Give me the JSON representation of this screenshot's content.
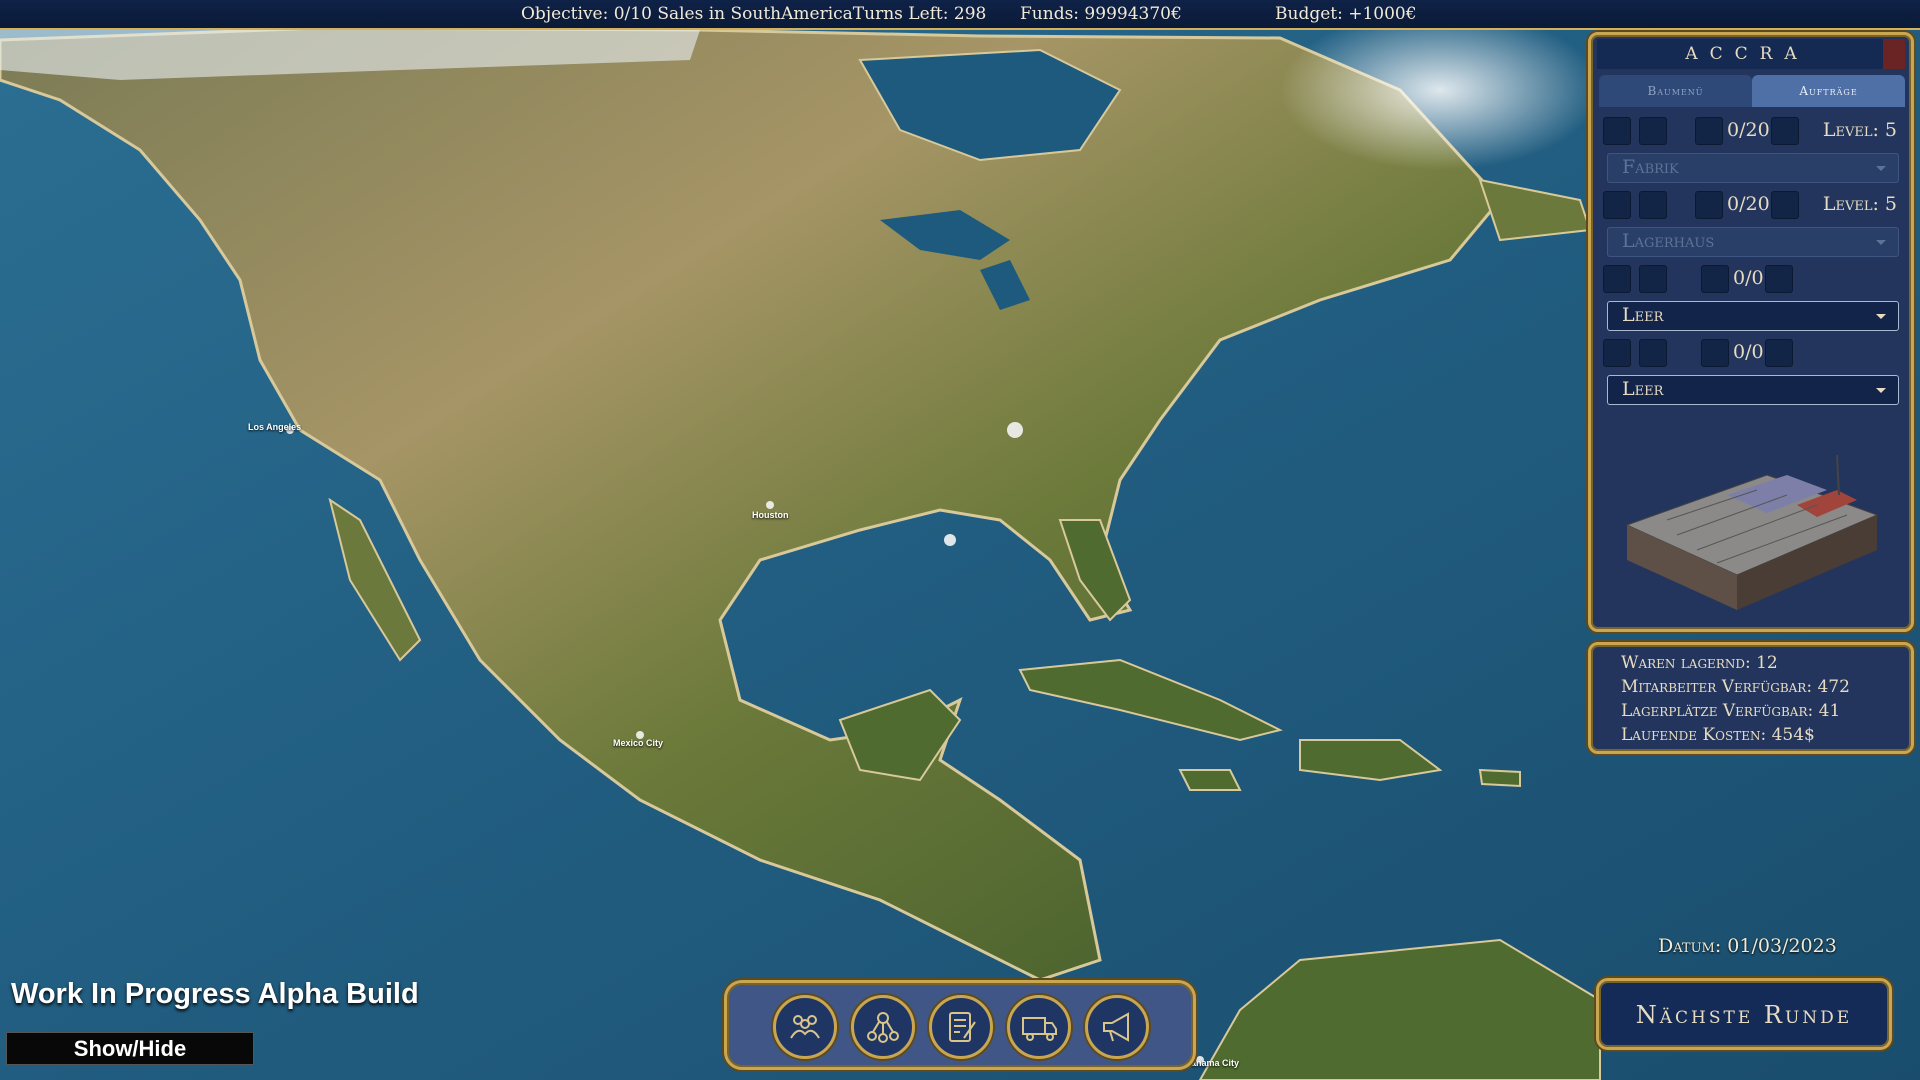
{
  "topbar": {
    "objective": "Objective:  0/10 Sales in SouthAmericaTurns Left: 298",
    "funds": "Funds: 99994370€",
    "budget": "Budget: +1000€"
  },
  "city_panel": {
    "title": "ACCRA",
    "tabs": [
      "Baumenü",
      "Aufträge"
    ],
    "active_tab": "Aufträge",
    "rows": [
      {
        "count": "0/20",
        "level": "Level: 5",
        "building": "Fabrik",
        "enabled": false
      },
      {
        "count": "0/20",
        "level": "Level: 5",
        "building": "Lagerhaus",
        "enabled": false
      },
      {
        "count": "0/0",
        "level": "",
        "building": "Leer",
        "enabled": true
      },
      {
        "count": "0/0",
        "level": "",
        "building": "Leer",
        "enabled": true
      }
    ]
  },
  "stats": {
    "waren": "Waren lagernd: 12",
    "mitarbeiter": "Mitarbeiter Verfügbar: 472",
    "lagerplaetze": "Lagerplätze Verfügbar: 41",
    "kosten": "Laufende Kosten: 454$"
  },
  "date": "Datum: 01/03/2023",
  "next_round": "Nächste Runde",
  "toolbar_icons": [
    "people-icon",
    "network-icon",
    "contract-icon",
    "truck-icon",
    "megaphone-icon"
  ],
  "wip_label": "Work In Progress Alpha Build",
  "show_hide": "Show/Hide",
  "map_labels": {
    "city_1": "Los Angeles",
    "city_2": "Houston",
    "city_3": "Mexico City",
    "city_4": "Panama City"
  },
  "colors": {
    "gold": "#c9a652",
    "panel": "#23355c",
    "ocean": "#1f5a7e",
    "land": "#6b7a3c"
  }
}
